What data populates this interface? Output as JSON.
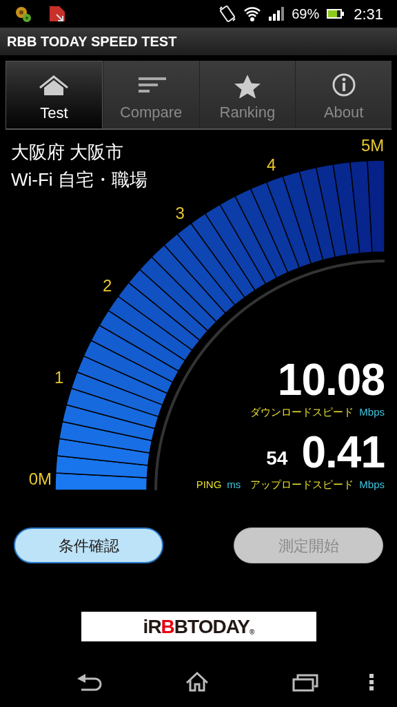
{
  "status_bar": {
    "battery_text": "69%",
    "time": "2:31"
  },
  "app_title": "RBB TODAY SPEED TEST",
  "tabs": [
    {
      "label": "Test",
      "kind": "home",
      "selected": true
    },
    {
      "label": "Compare",
      "kind": "bars",
      "selected": false
    },
    {
      "label": "Ranking",
      "kind": "star",
      "selected": false
    },
    {
      "label": "About",
      "kind": "info",
      "selected": false
    }
  ],
  "location": [
    "大阪府 大阪市",
    "Wi-Fi 自宅・職場"
  ],
  "gauge": {
    "ticks": [
      "0M",
      "1",
      "2",
      "3",
      "4",
      "5M"
    ]
  },
  "readings": [
    {
      "value": "10.08",
      "label": "ダウンロードスピード",
      "unit": "Mbps"
    },
    {
      "value": "0.41",
      "label": "アップロードスピード",
      "unit": "Mbps"
    }
  ],
  "ping": {
    "value": "54",
    "label": "PING",
    "unit": "ms"
  },
  "buttons": [
    {
      "label": "条件確認",
      "disabled": false
    },
    {
      "label": "測定開始",
      "disabled": true
    }
  ],
  "logo": {
    "parts": [
      {
        "text": "iR",
        "color": "#231815"
      },
      {
        "text": "B",
        "color": "#e60012"
      },
      {
        "text": "B",
        "color": "#231815"
      },
      {
        "text": "TODAY",
        "color": "#231815"
      }
    ],
    "mark": "®"
  }
}
